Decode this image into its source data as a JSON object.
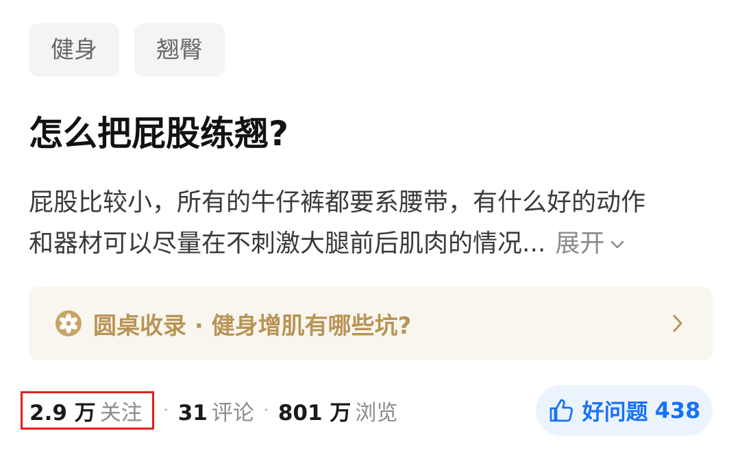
{
  "tags": [
    "健身",
    "翘臀"
  ],
  "question": {
    "title": "怎么把屁股练翘?",
    "excerpt_line1": "屁股比较小，所有的牛仔裤都要系腰带，有什么好的动作",
    "excerpt_line2": "和器材可以尽量在不刺激大腿前后肌肉的情况...",
    "expand_label": "展开"
  },
  "collection": {
    "text": "圆桌收录 · 健身增肌有哪些坑?",
    "icon": "roundtable-icon"
  },
  "stats": {
    "followers_num": "2.9 万",
    "followers_label": "关注",
    "comments_num": "31",
    "comments_label": "评论",
    "views_num": "801 万",
    "views_label": "浏览",
    "separator": "·"
  },
  "good_question": {
    "label": "好问题",
    "count": "438"
  },
  "colors": {
    "accent_blue": "#1772f6",
    "gold": "#b89455",
    "highlight_red": "#e0201b"
  }
}
